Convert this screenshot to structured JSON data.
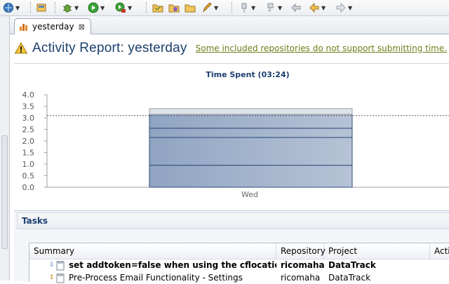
{
  "tab": {
    "label": "yesterday"
  },
  "header": {
    "title": "Activity Report: yesterday",
    "link": "Some included repositories do not support submitting time."
  },
  "chart_data": {
    "type": "bar",
    "title": "Time Spent (03:24)",
    "categories": [
      "Wed"
    ],
    "segments": [
      0.95,
      1.2,
      0.4,
      0.6,
      0.25
    ],
    "total": 3.4,
    "ylim": [
      0,
      4.0
    ],
    "yticks": [
      "0.0",
      "0.5",
      "1.0",
      "1.5",
      "2.0",
      "2.5",
      "3.0",
      "3.5",
      "4.0"
    ],
    "reference_line": 3.1,
    "colors": {
      "bar": "#9eb0c9",
      "bar_edge": "#2f4c7a",
      "cap": "#dfe3e8"
    }
  },
  "tasks": {
    "title": "Tasks",
    "columns": [
      "Summary",
      "Repository",
      "Project",
      "Acti"
    ],
    "rows": [
      {
        "summary": "set addtoken=false when using the cflocation tag",
        "repository": "ricomaha",
        "project": "DataTrack",
        "bold": true
      },
      {
        "summary": "Pre-Process Email Functionality - Settings",
        "repository": "ricomaha",
        "project": "DataTrack",
        "bold": false
      }
    ]
  },
  "icons": [
    "globe-icon",
    "app-icon",
    "debug-icon",
    "run-icon",
    "run-ext-icon",
    "open-folder-icon",
    "open-type-icon",
    "folder-icon",
    "pen-icon",
    "pin-icon",
    "nav-icon",
    "back-edit-icon",
    "back-icon",
    "forward-icon",
    "chart-tab-icon",
    "warning-icon"
  ]
}
